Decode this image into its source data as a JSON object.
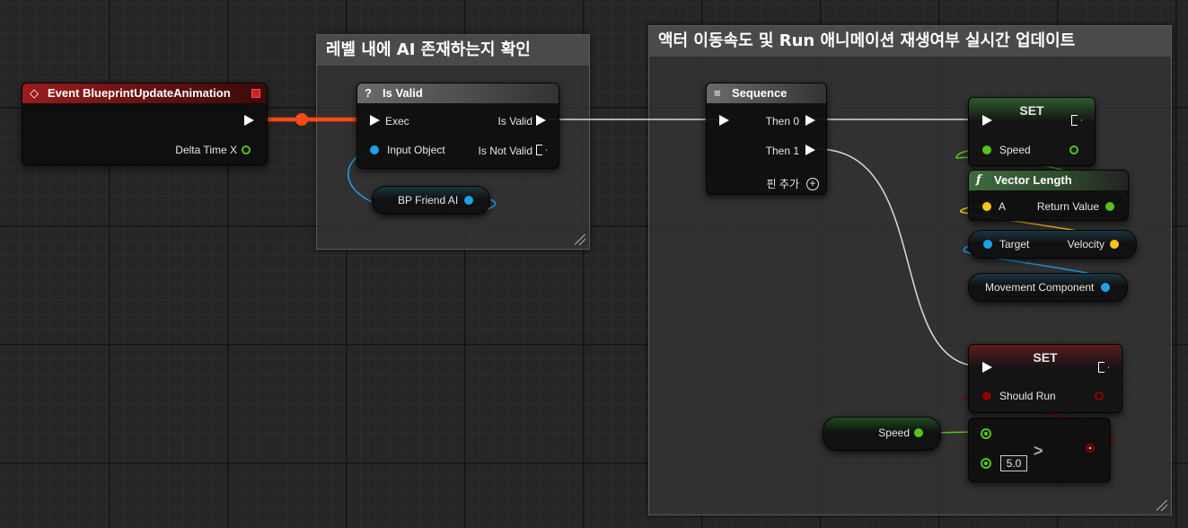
{
  "comments": {
    "ai_check": {
      "title": "레벨 내에 AI 존재하는지 확인"
    },
    "movement": {
      "title": "액터 이동속도 및 Run 애니메이션 재생여부 실시간 업데이트"
    }
  },
  "event_node": {
    "title": "Event BlueprintUpdateAnimation",
    "icon": "event-diamond-icon",
    "delta_label": "Delta Time X"
  },
  "is_valid_node": {
    "title": "Is Valid",
    "icon": "question-icon",
    "exec_label": "Exec",
    "input_object_label": "Input Object",
    "is_valid_label": "Is Valid",
    "is_not_valid_label": "Is Not Valid"
  },
  "bp_friend_ai": {
    "label": "BP Friend AI"
  },
  "sequence_node": {
    "title": "Sequence",
    "icon": "sequence-icon",
    "then0_label": "Then 0",
    "then1_label": "Then 1",
    "add_pin_label": "핀 추가"
  },
  "set_speed_node": {
    "title": "SET",
    "speed_label": "Speed"
  },
  "vector_length_node": {
    "title": "Vector Length",
    "icon": "function-icon",
    "a_label": "A",
    "return_label": "Return Value"
  },
  "velocity_node": {
    "target_label": "Target",
    "velocity_label": "Velocity"
  },
  "movement_component": {
    "label": "Movement Component"
  },
  "set_run_node": {
    "title": "SET",
    "should_run_label": "Should Run"
  },
  "speed_getter": {
    "label": "Speed"
  },
  "compare_node": {
    "operator": ">",
    "value": "5.0"
  },
  "colors": {
    "exec": "#ffffff",
    "object": "#1aa3e8",
    "float": "#52c41a",
    "vector": "#f5c518",
    "bool": "#8b0000",
    "active_wire": "#ff4a12"
  }
}
